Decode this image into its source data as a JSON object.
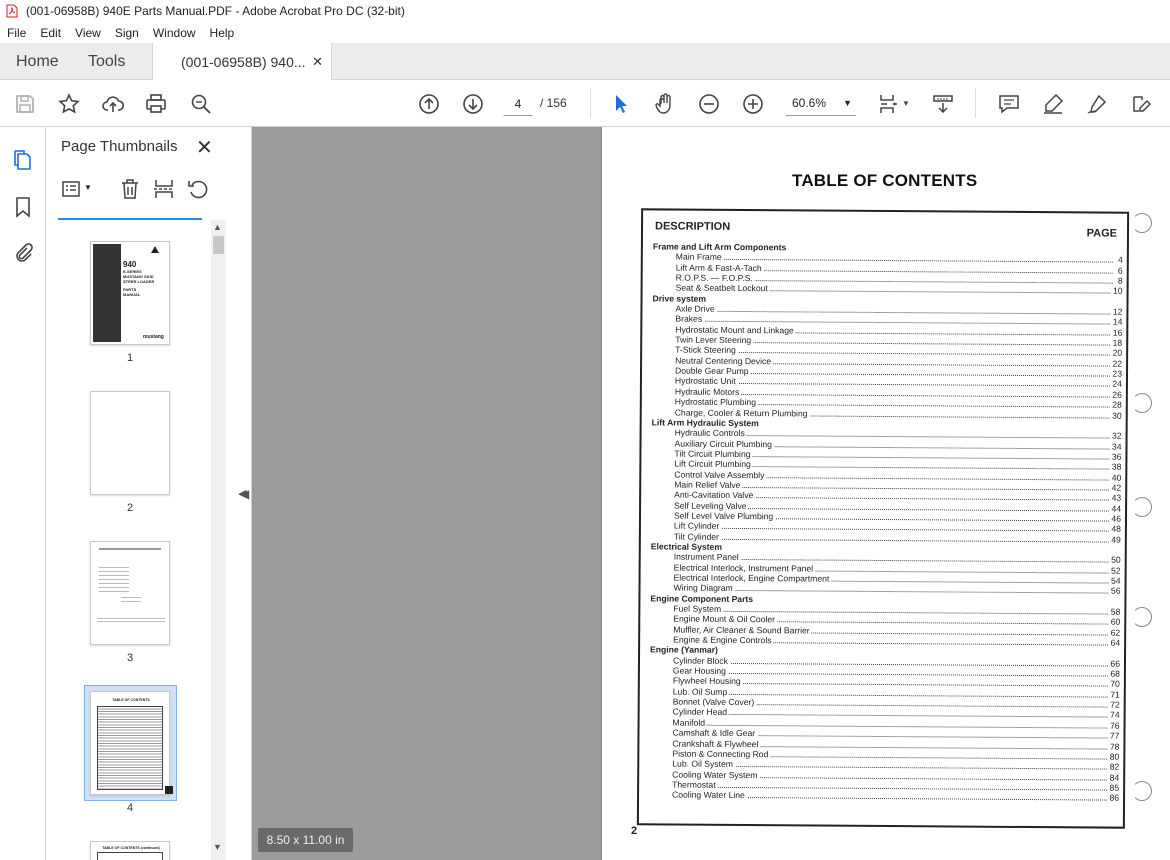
{
  "window": {
    "title": "(001-06958B) 940E Parts Manual.PDF - Adobe Acrobat Pro DC (32-bit)"
  },
  "menu": [
    "File",
    "Edit",
    "View",
    "Sign",
    "Window",
    "Help"
  ],
  "tabs": {
    "home": "Home",
    "tools": "Tools",
    "doc": "(001-06958B) 940..."
  },
  "nav": {
    "current_page": "4",
    "total": "/ 156",
    "zoom": "60.6%"
  },
  "panel": {
    "title": "Page Thumbnails",
    "thumb_labels": [
      "1",
      "2",
      "3",
      "4"
    ],
    "page_size": "8.50 x 11.00 in"
  },
  "thumb1": {
    "model": "940",
    "line1": "E-SERIES",
    "line2": "MUSTANG SKID",
    "line3": "STEER LOADER",
    "line4": "PARTS",
    "line5": "MANUAL",
    "brand": "mustang"
  },
  "thumb4": {
    "title": "TABLE OF CONTENTS"
  },
  "thumb5": {
    "title": "TABLE OF CONTENTS (continued)"
  },
  "doc": {
    "title": "TABLE OF CONTENTS",
    "desc_header": "DESCRIPTION",
    "page_header": "PAGE",
    "page_number": "2",
    "rows": [
      {
        "type": "sec",
        "text": "Frame and Lift Arm Components",
        "page": ""
      },
      {
        "type": "it",
        "text": "Main Frame",
        "page": "4"
      },
      {
        "type": "it",
        "text": "Lift Arm & Fast-A-Tach",
        "page": "6"
      },
      {
        "type": "it",
        "text": "R.O.P.S. — F.O.P.S.",
        "page": "8"
      },
      {
        "type": "it",
        "text": "Seat & Seatbelt Lockout",
        "page": "10"
      },
      {
        "type": "sec",
        "text": "Drive system",
        "page": ""
      },
      {
        "type": "it",
        "text": "Axle Drive",
        "page": "12"
      },
      {
        "type": "it",
        "text": "Brakes",
        "page": "14"
      },
      {
        "type": "it",
        "text": "Hydrostatic Mount and Linkage",
        "page": "16"
      },
      {
        "type": "it",
        "text": "Twin Lever Steering",
        "page": "18"
      },
      {
        "type": "it",
        "text": "T-Stick Steering",
        "page": "20"
      },
      {
        "type": "it",
        "text": "Neutral Centering Device",
        "page": "22"
      },
      {
        "type": "it",
        "text": "Double Gear Pump",
        "page": "23"
      },
      {
        "type": "it",
        "text": "Hydrostatic Unit",
        "page": "24"
      },
      {
        "type": "it",
        "text": "Hydraulic Motors",
        "page": "26"
      },
      {
        "type": "it",
        "text": "Hydrostatic Plumbing",
        "page": "28"
      },
      {
        "type": "it",
        "text": "Charge, Cooler & Return Plumbing",
        "page": "30"
      },
      {
        "type": "sec",
        "text": "Lift Arm Hydraulic System",
        "page": ""
      },
      {
        "type": "it",
        "text": "Hydraulic Controls",
        "page": "32"
      },
      {
        "type": "it",
        "text": "Auxiliary Circuit Plumbing",
        "page": "34"
      },
      {
        "type": "it",
        "text": "Tilt Circuit Plumbing",
        "page": "36"
      },
      {
        "type": "it",
        "text": "Lift Circuit Plumbing",
        "page": "38"
      },
      {
        "type": "it",
        "text": "Control Valve Assembly",
        "page": "40"
      },
      {
        "type": "it",
        "text": "Main Relief Valve",
        "page": "42"
      },
      {
        "type": "it",
        "text": "Anti-Cavitation Valve",
        "page": "43"
      },
      {
        "type": "it",
        "text": "Self Leveling Valve",
        "page": "44"
      },
      {
        "type": "it",
        "text": "Self Level Valve Plumbing",
        "page": "46"
      },
      {
        "type": "it",
        "text": "Lift Cylinder",
        "page": "48"
      },
      {
        "type": "it",
        "text": "Tilt Cylinder",
        "page": "49"
      },
      {
        "type": "sec",
        "text": "Electrical System",
        "page": ""
      },
      {
        "type": "it",
        "text": "Instrument Panel",
        "page": "50"
      },
      {
        "type": "it",
        "text": "Electrical Interlock, Instrument Panel",
        "page": "52"
      },
      {
        "type": "it",
        "text": "Electrical Interlock, Engine Compartment",
        "page": "54"
      },
      {
        "type": "it",
        "text": "Wiring Diagram",
        "page": "56"
      },
      {
        "type": "sec",
        "text": "Engine Component Parts",
        "page": ""
      },
      {
        "type": "it",
        "text": "Fuel System",
        "page": "58"
      },
      {
        "type": "it",
        "text": "Engine Mount & Oil Cooler",
        "page": "60"
      },
      {
        "type": "it",
        "text": "Muffler, Air Cleaner & Sound Barrier",
        "page": "62"
      },
      {
        "type": "it",
        "text": "Engine & Engine Controls",
        "page": "64"
      },
      {
        "type": "sec",
        "text": "Engine (Yanmar)",
        "page": ""
      },
      {
        "type": "it",
        "text": "Cylinder Block",
        "page": "66"
      },
      {
        "type": "it",
        "text": "Gear Housing",
        "page": "68"
      },
      {
        "type": "it",
        "text": "Flywheel Housing",
        "page": "70"
      },
      {
        "type": "it",
        "text": "Lub. Oil Sump",
        "page": "71"
      },
      {
        "type": "it",
        "text": "Bonnet (Valve Cover)",
        "page": "72"
      },
      {
        "type": "it",
        "text": "Cylinder Head",
        "page": "74"
      },
      {
        "type": "it",
        "text": "Manifold",
        "page": "76"
      },
      {
        "type": "it",
        "text": "Camshaft & Idle Gear",
        "page": "77"
      },
      {
        "type": "it",
        "text": "Crankshaft & Flywheel",
        "page": "78"
      },
      {
        "type": "it",
        "text": "Piston & Connecting Rod",
        "page": "80"
      },
      {
        "type": "it",
        "text": "Lub. Oil System",
        "page": "82"
      },
      {
        "type": "it",
        "text": "Cooling Water System",
        "page": "84"
      },
      {
        "type": "it",
        "text": "Thermostat",
        "page": "85"
      },
      {
        "type": "it",
        "text": "Cooling Water Line",
        "page": "86"
      }
    ]
  }
}
